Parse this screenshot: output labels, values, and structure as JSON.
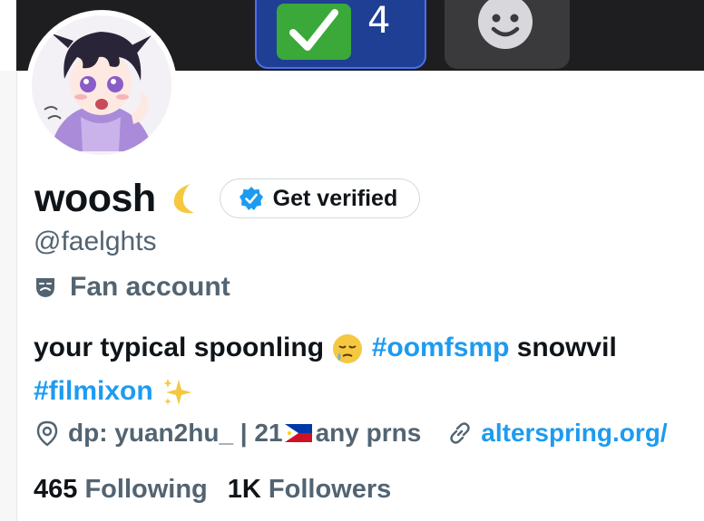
{
  "banner": {
    "tiles": [
      {
        "icon": "check-mark-icon",
        "count": "4",
        "color": "#3aa93a"
      },
      {
        "icon": "smiley-face-icon"
      }
    ]
  },
  "profile": {
    "avatar_icon": "anime-avatar-icon",
    "display_name": "woosh",
    "name_emoji": "crescent-moon-icon",
    "verify_button_label": "Get verified",
    "handle": "@faelghts",
    "category_icon": "mask-icon",
    "category": "Fan account",
    "bio": {
      "line1_text": "your typical spoonling",
      "line1_emoji": "sleepy-face-emoji",
      "line1_hashtag": "#oomfsmp",
      "line1_rest": "snowvil",
      "line2_hashtag": "#filmixon",
      "line2_emoji": "sparkles-emoji"
    },
    "location_icon": "location-pin-icon",
    "location_prefix": "dp: yuan2hu_ | 21",
    "location_flag": "philippines-flag-icon",
    "location_suffix": "any prns",
    "link_icon": "link-icon",
    "link_text": "alterspring.org/"
  },
  "stats": {
    "following_count": "465",
    "following_label": "Following",
    "followers_count": "1K",
    "followers_label": "Followers"
  },
  "colors": {
    "accent": "#1d9bf0",
    "secondary_text": "#536471",
    "banner_bg": "#1e1e20"
  }
}
